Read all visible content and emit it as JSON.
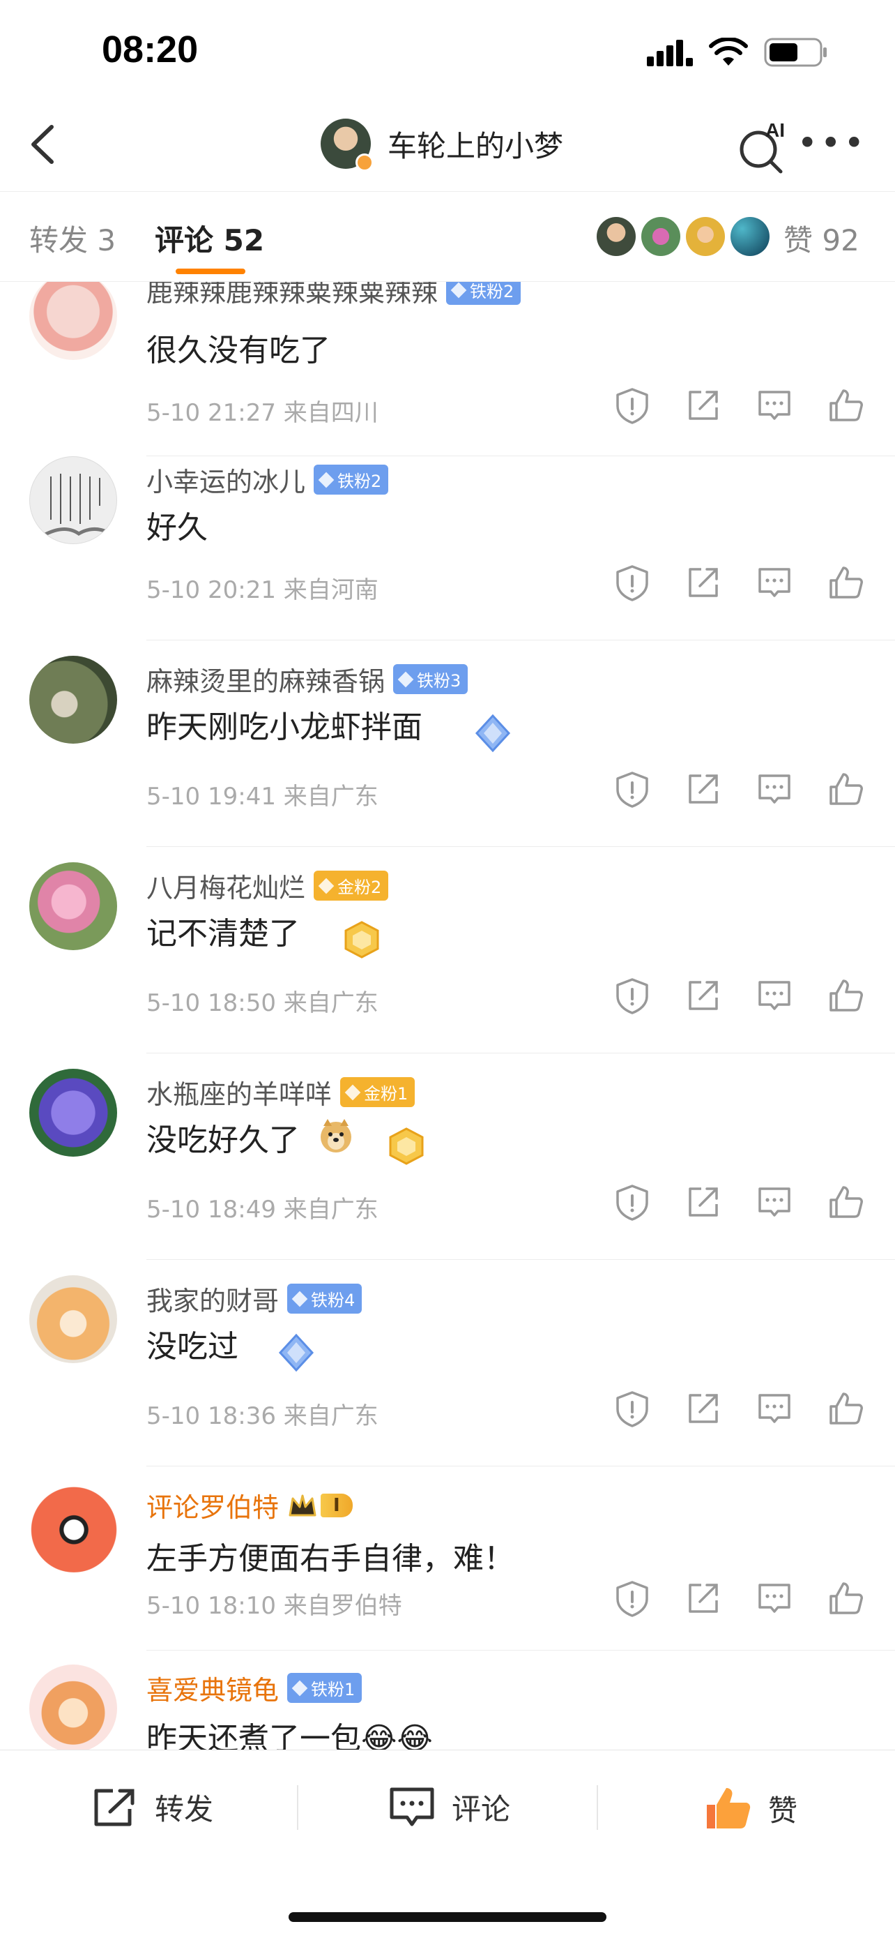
{
  "status_bar": {
    "time": "08:20"
  },
  "header": {
    "title": "车轮上的小梦",
    "ai_label": "AI"
  },
  "tabs": {
    "repost": "转发 3",
    "comment": "评论 52",
    "likes": "赞 92"
  },
  "comments": [
    {
      "name": "鹿辣辣鹿辣辣粟辣粟辣辣",
      "badge": "铁粉2",
      "badge_type": "iron",
      "text": "很久没有吃了",
      "meta": "5-10 21:27 来自四川"
    },
    {
      "name": "小幸运的冰儿",
      "badge": "铁粉2",
      "badge_type": "iron",
      "text": "好久",
      "meta": "5-10 20:21 来自河南"
    },
    {
      "name": "麻辣烫里的麻辣香锅",
      "badge": "铁粉3",
      "badge_type": "iron",
      "text": "昨天刚吃小龙虾拌面",
      "meta": "5-10 19:41 来自广东"
    },
    {
      "name": "八月梅花灿烂",
      "badge": "金粉2",
      "badge_type": "gold",
      "text": "记不清楚了",
      "meta": "5-10 18:50 来自广东"
    },
    {
      "name": "水瓶座的羊咩咩",
      "badge": "金粉1",
      "badge_type": "gold",
      "text": "没吃好久了",
      "meta": "5-10 18:49 来自广东"
    },
    {
      "name": "我家的财哥",
      "badge": "铁粉4",
      "badge_type": "iron",
      "text": "没吃过",
      "meta": "5-10 18:36 来自广东"
    },
    {
      "name": "评论罗伯特",
      "badge": "I",
      "badge_type": "crown",
      "text": "左手方便面右手自律，难！",
      "meta": "5-10 18:10 来自罗伯特"
    },
    {
      "name": "喜爱典镜龟",
      "badge": "铁粉1",
      "badge_type": "iron",
      "text": "昨天还煮了一包😂😂",
      "meta": ""
    }
  ],
  "bottom_bar": {
    "repost": "转发",
    "comment": "评论",
    "like": "赞"
  },
  "colors": {
    "accent": "#ff8200",
    "iron_badge": "#6d9eee",
    "gold_badge": "#f5b22e",
    "name_vip": "#e8740c"
  }
}
